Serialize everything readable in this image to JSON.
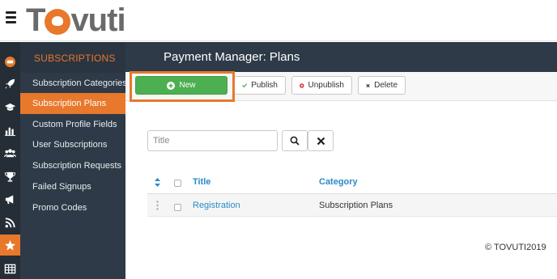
{
  "app": {
    "logo_text": "Tovuti",
    "brand_color": "#e8782b"
  },
  "iconbar": {
    "icons": [
      "tovuti-badge-icon",
      "rocket-icon",
      "graduation-cap-icon",
      "bar-chart-icon",
      "users-icon",
      "trophy-icon",
      "megaphone-icon",
      "rss-icon",
      "star-icon",
      "table-icon"
    ],
    "active": "star-icon"
  },
  "sidebar": {
    "heading": "SUBSCRIPTIONS",
    "items": [
      {
        "label": "Subscription Categories",
        "active": false
      },
      {
        "label": "Subscription Plans",
        "active": true
      },
      {
        "label": "Custom Profile Fields",
        "active": false
      },
      {
        "label": "User Subscriptions",
        "active": false
      },
      {
        "label": "Subscription Requests",
        "active": false
      },
      {
        "label": "Failed Signups",
        "active": false
      },
      {
        "label": "Promo Codes",
        "active": false
      }
    ]
  },
  "page": {
    "title": "Payment Manager: Plans"
  },
  "toolbar": {
    "new_label": "New",
    "publish_label": "Publish",
    "unpublish_label": "Unpublish",
    "delete_label": "Delete"
  },
  "search": {
    "placeholder": "Title",
    "value": ""
  },
  "table": {
    "columns": [
      "Title",
      "Category"
    ],
    "rows": [
      {
        "title": "Registration",
        "category": "Subscription Plans"
      }
    ]
  },
  "footer": {
    "text": "© TOVUTI2019"
  }
}
